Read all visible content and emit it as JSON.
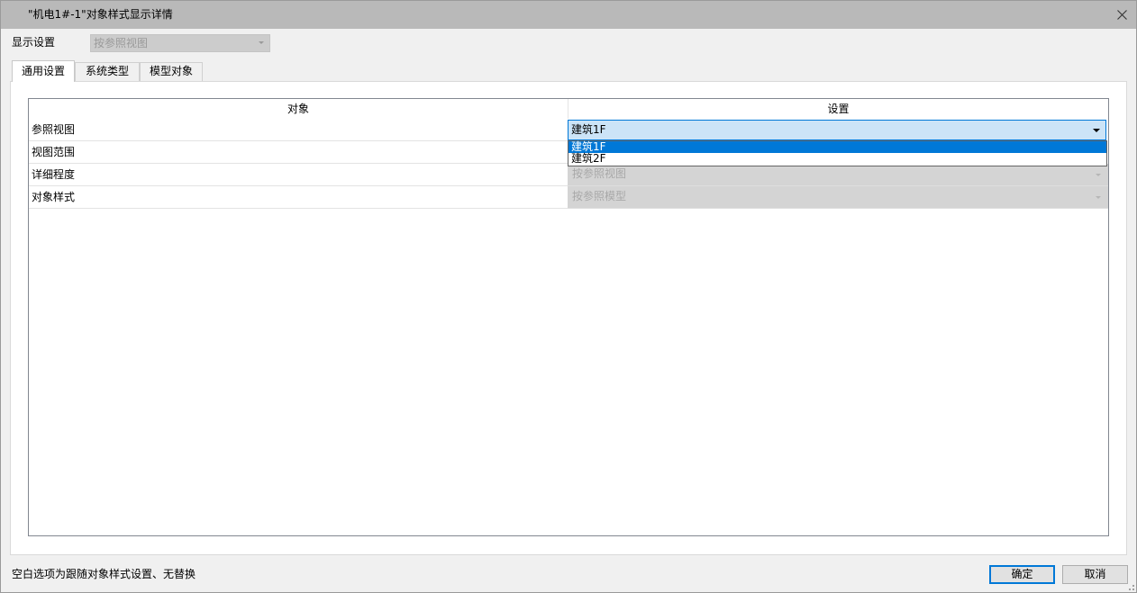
{
  "window": {
    "title": "\"机电1#-1\"对象样式显示详情",
    "close_icon": "close-icon"
  },
  "display_setting": {
    "label": "显示设置",
    "value": "按参照视图"
  },
  "tabs": [
    {
      "label": "通用设置",
      "active": true
    },
    {
      "label": "系统类型",
      "active": false
    },
    {
      "label": "模型对象",
      "active": false
    }
  ],
  "grid": {
    "headers": {
      "object": "对象",
      "setting": "设置"
    },
    "rows": [
      {
        "name": "参照视图",
        "value": "建筑1F",
        "state": "open"
      },
      {
        "name": "视图范围",
        "value": "",
        "state": "covered"
      },
      {
        "name": "详细程度",
        "value": "按参照视图",
        "state": "disabled"
      },
      {
        "name": "对象样式",
        "value": "按参照模型",
        "state": "disabled"
      }
    ]
  },
  "dropdown": {
    "options": [
      "建筑1F",
      "建筑2F"
    ],
    "selected_index": 0
  },
  "footer": {
    "hint": "空白选项为跟随对象样式设置、无替换",
    "ok_label": "确定",
    "cancel_label": "取消"
  },
  "colors": {
    "accent": "#0078d7",
    "selection_bg": "#cce4f7",
    "titlebar": "#b9b9b9"
  }
}
